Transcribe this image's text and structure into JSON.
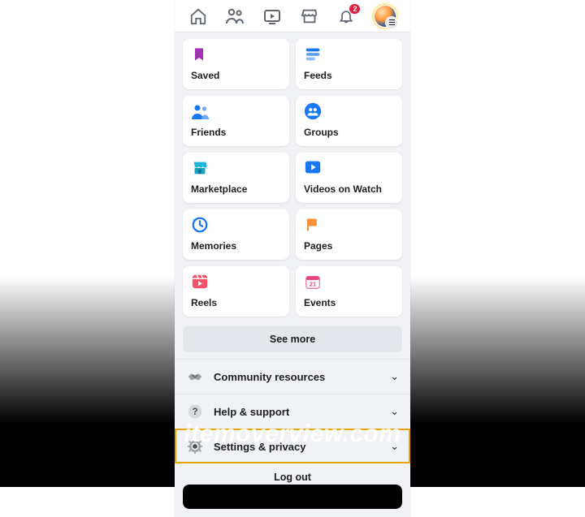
{
  "topnav": {
    "notification_badge": "2"
  },
  "shortcuts": {
    "saved": {
      "label": "Saved"
    },
    "feeds": {
      "label": "Feeds"
    },
    "friends": {
      "label": "Friends"
    },
    "groups": {
      "label": "Groups"
    },
    "marketplace": {
      "label": "Marketplace"
    },
    "videos": {
      "label": "Videos on Watch"
    },
    "memories": {
      "label": "Memories"
    },
    "pages": {
      "label": "Pages"
    },
    "reels": {
      "label": "Reels"
    },
    "events": {
      "label": "Events"
    }
  },
  "see_more_label": "See more",
  "rows": {
    "community": {
      "label": "Community resources"
    },
    "help": {
      "label": "Help & support"
    },
    "settings": {
      "label": "Settings & privacy"
    }
  },
  "logout_label": "Log out",
  "watermark": "itemoverview.com"
}
